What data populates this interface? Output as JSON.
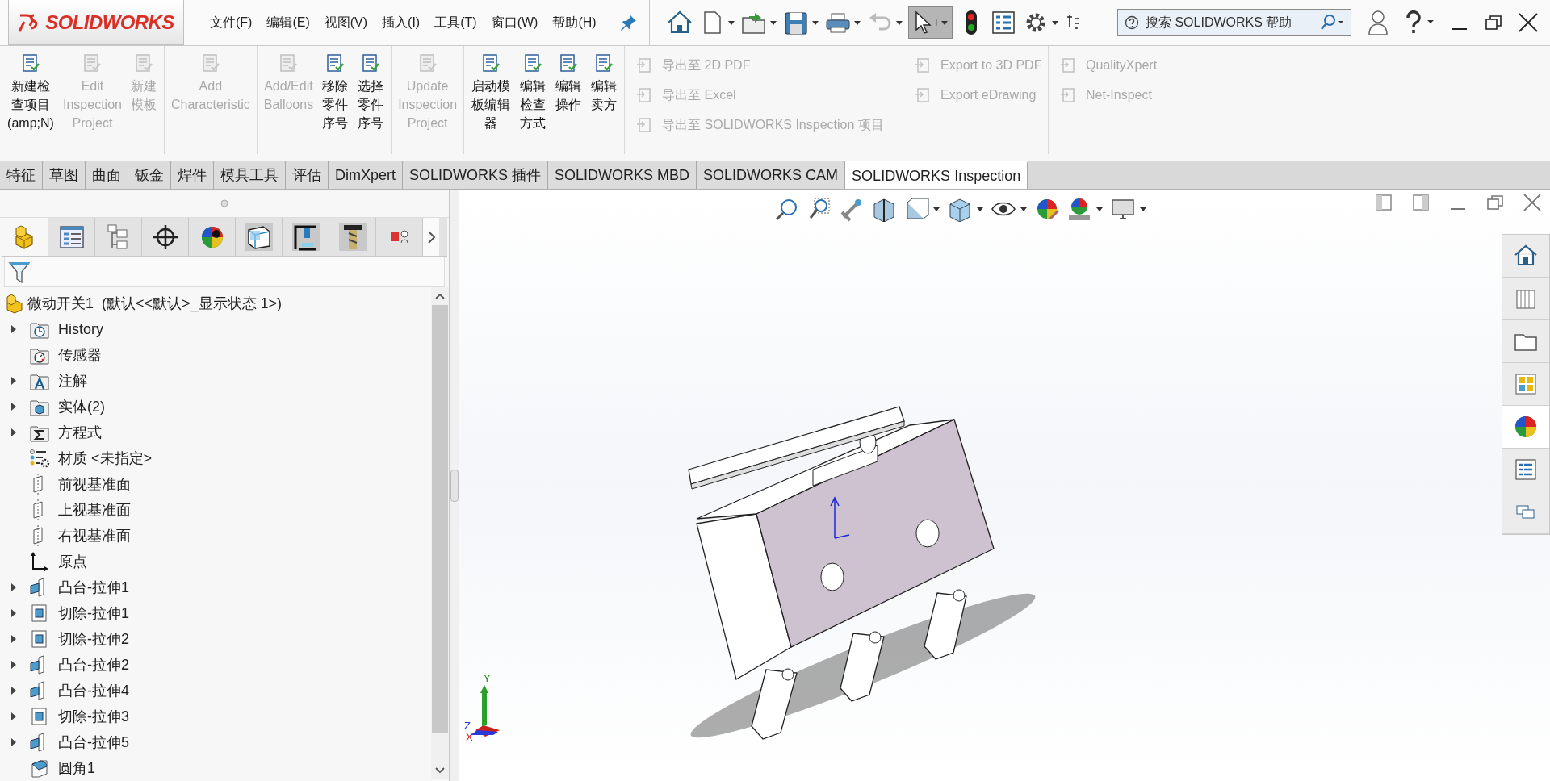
{
  "app": {
    "logo": "SOLIDWORKS"
  },
  "menu": [
    "文件(F)",
    "编辑(E)",
    "视图(V)",
    "插入(I)",
    "工具(T)",
    "窗口(W)",
    "帮助(H)"
  ],
  "search": {
    "placeholder": "搜索 SOLIDWORKS 帮助"
  },
  "ribbon": {
    "groups": [
      [
        {
          "label": "新建检查项目(amp;N)",
          "disabled": false
        },
        {
          "label": "Edit\nInspection\nProject",
          "disabled": true
        },
        {
          "label": "新建模板",
          "disabled": true
        }
      ],
      [
        {
          "label": "Add\nCharacteristic",
          "disabled": true
        }
      ],
      [
        {
          "label": "Add/Edit\nBalloons",
          "disabled": true
        },
        {
          "label": "移除零件序号",
          "disabled": false
        },
        {
          "label": "选择零件序号",
          "disabled": false
        }
      ],
      [
        {
          "label": "Update\nInspection\nProject",
          "disabled": true
        }
      ],
      [
        {
          "label": "启动模板编辑器",
          "disabled": false
        },
        {
          "label": "编辑检查方式",
          "disabled": false
        },
        {
          "label": "编辑操作",
          "disabled": false
        },
        {
          "label": "编辑卖方",
          "disabled": false
        }
      ]
    ],
    "small_columns": [
      [
        {
          "label": "导出至 2D PDF",
          "disabled": true
        },
        {
          "label": "导出至 Excel",
          "disabled": true
        },
        {
          "label": "导出至 SOLIDWORKS Inspection 项目",
          "disabled": true
        }
      ],
      [
        {
          "label": "Export to 3D PDF",
          "disabled": true
        },
        {
          "label": "Export eDrawing",
          "disabled": true
        }
      ],
      [
        {
          "label": "QualityXpert",
          "disabled": true
        },
        {
          "label": "Net-Inspect",
          "disabled": true
        }
      ]
    ]
  },
  "tabs": [
    {
      "label": "特征",
      "selected": false
    },
    {
      "label": "草图",
      "selected": false
    },
    {
      "label": "曲面",
      "selected": false
    },
    {
      "label": "钣金",
      "selected": false
    },
    {
      "label": "焊件",
      "selected": false
    },
    {
      "label": "模具工具",
      "selected": false
    },
    {
      "label": "评估",
      "selected": false
    },
    {
      "label": "DimXpert",
      "selected": false
    },
    {
      "label": "SOLIDWORKS 插件",
      "selected": false
    },
    {
      "label": "SOLIDWORKS MBD",
      "selected": false
    },
    {
      "label": "SOLIDWORKS CAM",
      "selected": false
    },
    {
      "label": "SOLIDWORKS Inspection",
      "selected": true
    }
  ],
  "tree": {
    "root": "微动开关1  (默认<<默认>_显示状态 1>)",
    "items": [
      {
        "label": "History",
        "kind": "history",
        "expandable": true
      },
      {
        "label": "传感器",
        "kind": "sensor",
        "expandable": false
      },
      {
        "label": "注解",
        "kind": "annotation",
        "expandable": true
      },
      {
        "label": "实体(2)",
        "kind": "body",
        "expandable": true
      },
      {
        "label": "方程式",
        "kind": "equation",
        "expandable": true
      },
      {
        "label": "材质 <未指定>",
        "kind": "material",
        "expandable": false
      },
      {
        "label": "前视基准面",
        "kind": "plane",
        "expandable": false
      },
      {
        "label": "上视基准面",
        "kind": "plane",
        "expandable": false
      },
      {
        "label": "右视基准面",
        "kind": "plane",
        "expandable": false
      },
      {
        "label": "原点",
        "kind": "origin",
        "expandable": false
      },
      {
        "label": "凸台-拉伸1",
        "kind": "boss",
        "expandable": true
      },
      {
        "label": "切除-拉伸1",
        "kind": "cut",
        "expandable": true
      },
      {
        "label": "切除-拉伸2",
        "kind": "cut",
        "expandable": true
      },
      {
        "label": "凸台-拉伸2",
        "kind": "boss",
        "expandable": true
      },
      {
        "label": "凸台-拉伸4",
        "kind": "boss",
        "expandable": true
      },
      {
        "label": "切除-拉伸3",
        "kind": "cut",
        "expandable": true
      },
      {
        "label": "凸台-拉伸5",
        "kind": "boss",
        "expandable": true
      },
      {
        "label": "圆角1",
        "kind": "fillet",
        "expandable": false
      }
    ]
  },
  "panel_tabs": [
    {
      "selected": true
    },
    {
      "selected": false
    },
    {
      "selected": false
    },
    {
      "selected": false
    },
    {
      "selected": false
    },
    {
      "selected": false
    },
    {
      "selected": false
    },
    {
      "selected": false
    },
    {
      "selected": false
    }
  ],
  "task_pane": [
    {
      "selected": false
    },
    {
      "selected": false
    },
    {
      "selected": false
    },
    {
      "selected": false
    },
    {
      "selected": true
    },
    {
      "selected": false
    },
    {
      "selected": false
    }
  ],
  "triad": {
    "labels": [
      "Y",
      "Z",
      "X"
    ]
  }
}
